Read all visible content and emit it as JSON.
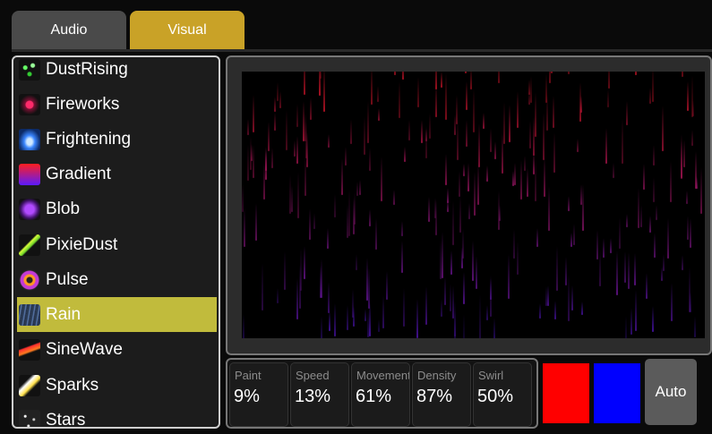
{
  "tabs": [
    {
      "label": "Audio",
      "active": false
    },
    {
      "label": "Visual",
      "active": true
    }
  ],
  "effects": [
    {
      "label": "DustRising",
      "icon": "dust-rising-icon",
      "selected": false
    },
    {
      "label": "Fireworks",
      "icon": "fireworks-icon",
      "selected": false
    },
    {
      "label": "Frightening",
      "icon": "frightening-icon",
      "selected": false
    },
    {
      "label": "Gradient",
      "icon": "gradient-icon",
      "selected": false
    },
    {
      "label": "Blob",
      "icon": "blob-icon",
      "selected": false
    },
    {
      "label": "PixieDust",
      "icon": "pixie-dust-icon",
      "selected": false
    },
    {
      "label": "Pulse",
      "icon": "pulse-icon",
      "selected": false
    },
    {
      "label": "Rain",
      "icon": "rain-icon",
      "selected": true
    },
    {
      "label": "SineWave",
      "icon": "sine-wave-icon",
      "selected": false
    },
    {
      "label": "Sparks",
      "icon": "sparks-icon",
      "selected": false
    },
    {
      "label": "Stars",
      "icon": "stars-icon",
      "selected": false
    }
  ],
  "params": [
    {
      "label": "Paint",
      "value": "9%"
    },
    {
      "label": "Speed",
      "value": "13%"
    },
    {
      "label": "Movement",
      "value": "61%"
    },
    {
      "label": "Density",
      "value": "87%"
    },
    {
      "label": "Swirl",
      "value": "50%"
    }
  ],
  "colors": {
    "primary": "#ff0000",
    "secondary": "#0000ff",
    "tab_active": "#c9a227",
    "selected_item": "#c1bb3c"
  },
  "auto_label": "Auto"
}
